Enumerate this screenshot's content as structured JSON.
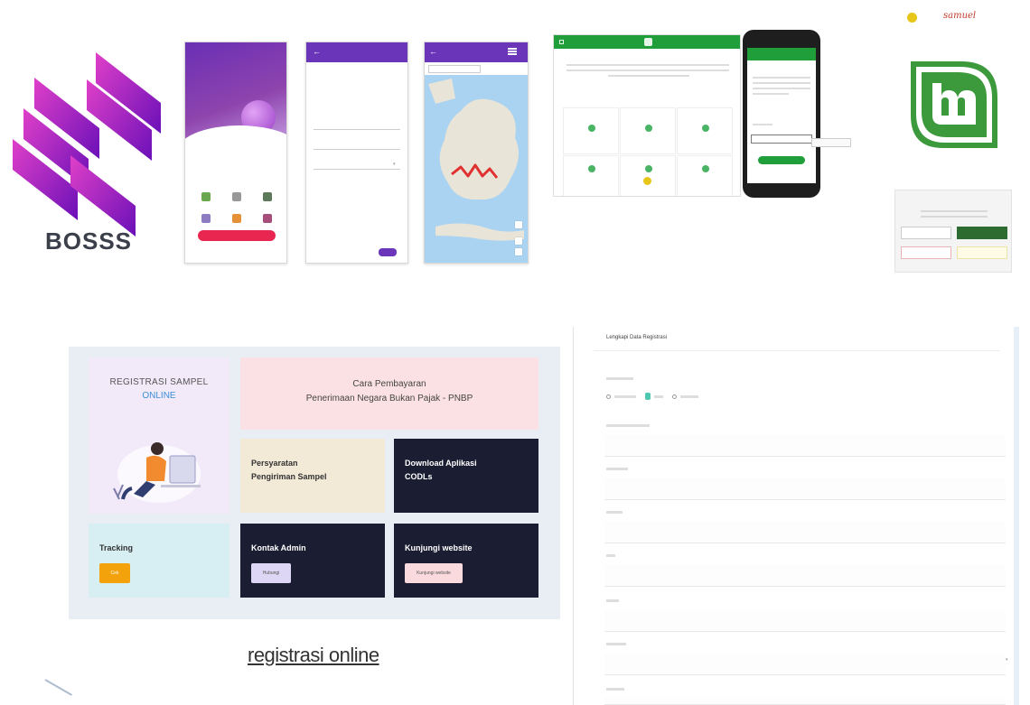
{
  "logo": {
    "brand_text": "BOSSS"
  },
  "mint_header": {
    "signature": "samuel"
  },
  "dashboard": {
    "registrasi_line1": "REGISTRASI SAMPEL",
    "registrasi_line2": "ONLINE",
    "cara_line1": "Cara Pembayaran",
    "cara_line2": "Penerimaan Negara Bukan Pajak - PNBP",
    "persyaratan_line1": "Persyaratan",
    "persyaratan_line2": "Pengiriman Sampel",
    "download_line1": "Download Aplikasi",
    "download_line2": "CODLs",
    "tracking_title": "Tracking",
    "tracking_button": "Cek",
    "kontak_title": "Kontak Admin",
    "kontak_button": "Hubungi",
    "kunjungi_title": "Kunjungi website",
    "kunjungi_button": "Kunjungi website"
  },
  "caption": {
    "text": "registrasi online"
  },
  "form": {
    "title": "Lengkapi Data Registrasi"
  },
  "colors": {
    "purple": "#6a35b8",
    "green": "#1f9e3a",
    "navy": "#1b1e33",
    "orange": "#f3a20c",
    "mint": "#3c9a3c"
  }
}
